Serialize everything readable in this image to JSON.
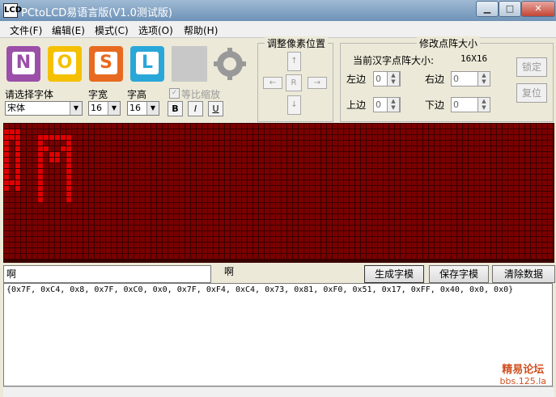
{
  "window": {
    "title": "PCtoLCD易语言版(V1.0测试版)",
    "app_icon_text": "LCD"
  },
  "menu": [
    "文件(F)",
    "编辑(E)",
    "模式(C)",
    "选项(O)",
    "帮助(H)"
  ],
  "logos": [
    {
      "letter": "N",
      "color": "#9B4FA8"
    },
    {
      "letter": "O",
      "color": "#F5C000"
    },
    {
      "letter": "S",
      "color": "#E86A20"
    },
    {
      "letter": "L",
      "color": "#2AA7D9"
    }
  ],
  "font": {
    "choose_label": "请选择字体",
    "font_value": "宋体",
    "width_label": "字宽",
    "width_value": "16",
    "height_label": "字高",
    "height_value": "16",
    "proportional_label": "等比缩放",
    "bold": "B",
    "italic": "I",
    "underline": "U"
  },
  "pixel_adjust": {
    "title": "调整像素位置",
    "up": "↑",
    "down": "↓",
    "left": "←",
    "right": "→",
    "reset": "R"
  },
  "matrix_size": {
    "title": "修改点阵大小",
    "current_label": "当前汉字点阵大小:",
    "current_value": "16X16",
    "left_label": "左边",
    "right_label": "右边",
    "top_label": "上边",
    "bottom_label": "下边",
    "left_value": "0",
    "right_value": "0",
    "top_value": "0",
    "bottom_value": "0",
    "lock_button": "锁定",
    "reset_button": "复位"
  },
  "input": {
    "value": "啊",
    "preview_char": "啊"
  },
  "buttons": {
    "generate": "生成字模",
    "save": "保存字模",
    "clear": "清除数据"
  },
  "output_text": "{0x7F, 0xC4, 0x8, 0x7F, 0xC0, 0x0, 0x7F, 0xF4, 0xC4, 0x73, 0x81, 0xF0, 0x51, 0x17, 0xFF, 0x40, 0x0, 0x0}",
  "watermark": {
    "line1": "精易论坛",
    "line2": "bbs.125.la"
  },
  "colors": {
    "matrix_off": "#7A0000",
    "matrix_on": "#E00000",
    "matrix_bg": "#3A0000"
  }
}
